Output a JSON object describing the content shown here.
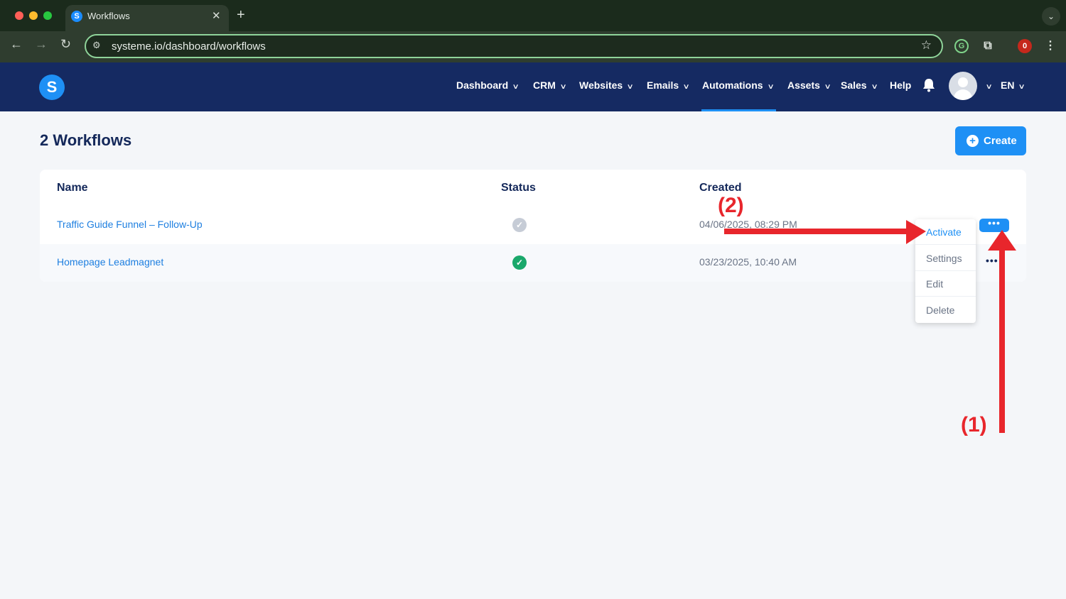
{
  "browser": {
    "tab_title": "Workflows",
    "tab_favicon_letter": "S",
    "url": "systeme.io/dashboard/workflows",
    "extension_badge": "0"
  },
  "header": {
    "logo_letter": "S",
    "nav": [
      {
        "label": "Dashboard",
        "has_dropdown": true
      },
      {
        "label": "CRM",
        "has_dropdown": true
      },
      {
        "label": "Websites",
        "has_dropdown": true
      },
      {
        "label": "Emails",
        "has_dropdown": true
      },
      {
        "label": "Automations",
        "has_dropdown": true,
        "active": true
      },
      {
        "label": "Assets",
        "has_dropdown": true
      },
      {
        "label": "Sales",
        "has_dropdown": true
      },
      {
        "label": "Help",
        "has_dropdown": false
      }
    ],
    "language": "EN"
  },
  "page": {
    "title": "2 Workflows",
    "create_label": "Create"
  },
  "table": {
    "columns": {
      "name": "Name",
      "status": "Status",
      "created": "Created"
    },
    "rows": [
      {
        "name": "Traffic Guide Funnel – Follow-Up",
        "status": "inactive",
        "created": "04/06/2025, 08:29 PM",
        "actions": "•••"
      },
      {
        "name": "Homepage Leadmagnet",
        "status": "active",
        "created": "03/23/2025, 10:40 AM",
        "actions": "•••"
      }
    ]
  },
  "dropdown": {
    "items": [
      {
        "label": "Activate",
        "highlighted": true
      },
      {
        "label": "Settings"
      },
      {
        "label": "Edit"
      },
      {
        "label": "Delete"
      }
    ]
  },
  "annotations": {
    "step1": "(1)",
    "step2": "(2)"
  },
  "colors": {
    "header_bg": "#152a62",
    "accent": "#1e90f5",
    "active_status": "#1aa86b",
    "inactive_status": "#c6ccd6",
    "annotation": "#e8262c"
  }
}
